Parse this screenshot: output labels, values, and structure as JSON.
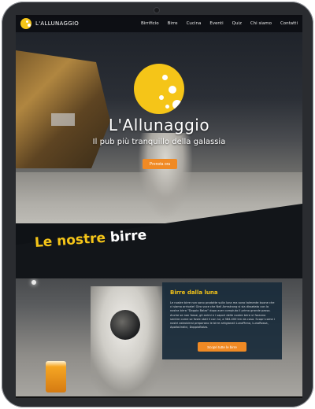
{
  "nav": {
    "brand": "L'ALLUNAGGIO",
    "items": [
      "Birrificio",
      "Birre",
      "Cucina",
      "Eventi",
      "Quiz",
      "Chi siamo",
      "Contatti"
    ]
  },
  "hero": {
    "title": "L'Allunaggio",
    "subtitle": "Il pub più tranquillo della galassia",
    "cta": "Prenota ora"
  },
  "section": {
    "title_part1": "Le nostre",
    "title_part2": "birre"
  },
  "card": {
    "title": "Birre dalla luna",
    "body": "Le nostre birre non sono prodotte sulla luna ma sono talmente buone che ci siamo arrivate! Gira voce che Neil Armstrong si sia dissetato con la nostra birra \"Doppio Balzo\" dopo aver compiuto il primo grande passo. Anche se non fosse, gli animi e i sapori delle nostre birre vi faranno sentire come se foste stati li con lui, a 384.400 km da casa. Scopri come i nostri astrobirrai preparano le birre artigianali LunaPiena, LunaRossa, ApolloUndici, DoppioBalzo.",
    "button": "Scopri tutte le birre"
  },
  "colors": {
    "accent": "#f5c518",
    "button": "#f08a24",
    "card": "#192b3b",
    "device": "#2a2c30"
  }
}
